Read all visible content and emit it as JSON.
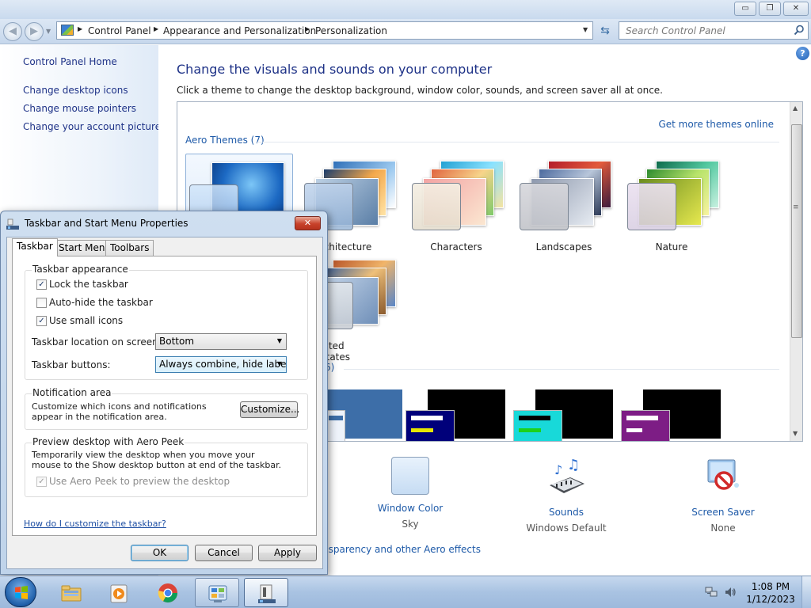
{
  "window": {
    "caption_min": "▭",
    "caption_max": "❐",
    "caption_close": "✕"
  },
  "address_bar": {
    "breadcrumbs": [
      "Control Panel",
      "Appearance and Personalization",
      "Personalization"
    ],
    "search_placeholder": "Search Control Panel"
  },
  "left_pane": {
    "home_link": "Control Panel Home",
    "links": [
      "Change desktop icons",
      "Change mouse pointers",
      "Change your account picture"
    ]
  },
  "main": {
    "title": "Change the visuals and sounds on your computer",
    "subtitle": "Click a theme to change the desktop background, window color, sounds, and screen saver all at once.",
    "get_more_link": "Get more themes online",
    "aero_group": "Aero Themes (7)",
    "basic_group_partial": "6)",
    "themes": [
      "rchitecture",
      "Characters",
      "Landscapes",
      "Nature",
      "nited States"
    ],
    "bottom_items": [
      {
        "label": "Window Color",
        "sub": "Sky"
      },
      {
        "label": "Sounds",
        "sub": "Windows Default"
      },
      {
        "label": "Screen Saver",
        "sub": "None"
      }
    ],
    "aero_link_partial": "nsparency and other Aero effects"
  },
  "dialog": {
    "title": "Taskbar and Start Menu Properties",
    "tabs": [
      "Taskbar",
      "Start Menu",
      "Toolbars"
    ],
    "appearance_group": "Taskbar appearance",
    "lock_taskbar": "Lock the taskbar",
    "auto_hide": "Auto-hide the taskbar",
    "small_icons": "Use small icons",
    "location_label": "Taskbar location on screen:",
    "location_value": "Bottom",
    "buttons_label": "Taskbar buttons:",
    "buttons_value": "Always combine, hide labels",
    "notification_group": "Notification area",
    "notification_desc": "Customize which icons and notifications appear in the notification area.",
    "customize_button": "Customize...",
    "peek_group": "Preview desktop with Aero Peek",
    "peek_desc": "Temporarily view the desktop when you move your mouse to the Show desktop button at end of the taskbar.",
    "peek_checkbox": "Use Aero Peek to preview the desktop",
    "help_link": "How do I customize the taskbar?",
    "ok": "OK",
    "cancel": "Cancel",
    "apply": "Apply",
    "states": {
      "lock_taskbar": true,
      "auto_hide": false,
      "small_icons": true,
      "peek": true
    }
  },
  "taskbar": {
    "time": "1:08 PM",
    "date": "1/12/2023",
    "pinned": [
      "start-button",
      "explorer",
      "media-player",
      "chrome",
      "control-panel",
      "taskbar-properties"
    ]
  },
  "colors": {
    "link_blue": "#1e5aa8",
    "title_blue": "#1e3287",
    "close_red": "#c7412a"
  }
}
